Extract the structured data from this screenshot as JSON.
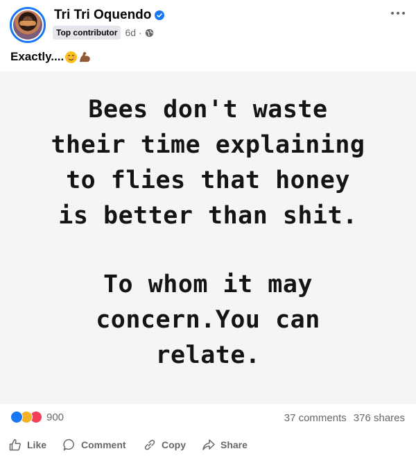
{
  "post": {
    "author": "Tri Tri Oquendo",
    "badge": "Top contributor",
    "time": "6d",
    "separator": "·",
    "caption": "Exactly....",
    "caption_emojis": [
      "smiling-face-emoji",
      "flexed-biceps-emoji"
    ]
  },
  "image": {
    "quote_lines": [
      "Bees don't waste",
      "their time explaining",
      "to flies that honey",
      "is better than shit."
    ],
    "quote_lines_2": [
      "To whom it may",
      "concern.You can",
      "relate."
    ]
  },
  "stats": {
    "reaction_count": "900",
    "reactions": [
      "like",
      "haha",
      "love"
    ],
    "comments": "37 comments",
    "shares": "376 shares"
  },
  "actions": {
    "like": "Like",
    "comment": "Comment",
    "copy": "Copy",
    "share": "Share"
  },
  "colors": {
    "accent": "#1877f2",
    "muted_text": "#65676b",
    "like": "#1877f2",
    "haha": "#f7b125",
    "love": "#f33e58"
  }
}
